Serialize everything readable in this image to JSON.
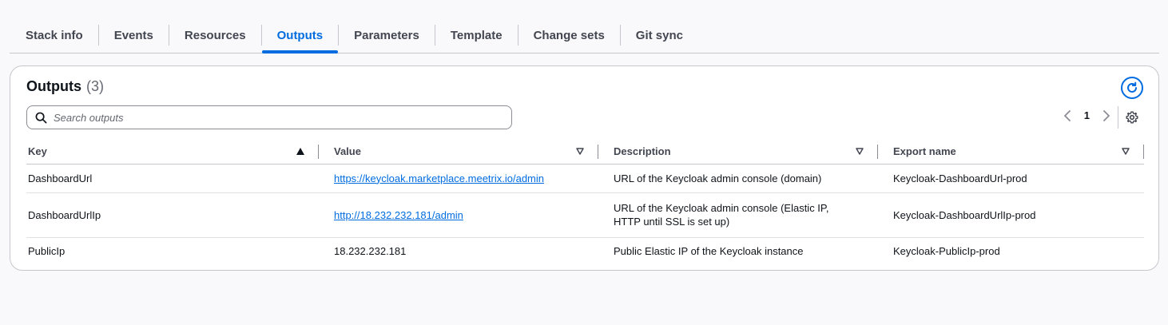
{
  "tabs": [
    {
      "label": "Stack info"
    },
    {
      "label": "Events"
    },
    {
      "label": "Resources"
    },
    {
      "label": "Outputs",
      "active": true
    },
    {
      "label": "Parameters"
    },
    {
      "label": "Template"
    },
    {
      "label": "Change sets"
    },
    {
      "label": "Git sync"
    }
  ],
  "panel": {
    "title": "Outputs",
    "count": "(3)",
    "refresh_icon": "refresh-icon"
  },
  "search": {
    "placeholder": "Search outputs",
    "value": "",
    "icon": "search-icon"
  },
  "pagination": {
    "current_page": "1",
    "prev_icon": "chevron-left-icon",
    "next_icon": "chevron-right-icon",
    "settings_icon": "gear-icon"
  },
  "table": {
    "columns": [
      {
        "label": "Key",
        "sort_icon": "sort-ascending-icon"
      },
      {
        "label": "Value",
        "sort_icon": "sort-icon"
      },
      {
        "label": "Description",
        "sort_icon": "sort-icon"
      },
      {
        "label": "Export name",
        "sort_icon": "sort-icon"
      }
    ],
    "rows": [
      {
        "key": "DashboardUrl",
        "value": "https://keycloak.marketplace.meetrix.io/admin",
        "description": "URL of the Keycloak admin console (domain)",
        "export_name": "Keycloak-DashboardUrl-prod"
      },
      {
        "key": "DashboardUrlIp",
        "value": "http://18.232.232.181/admin",
        "description": "URL of the Keycloak admin console (Elastic IP, HTTP until SSL is set up)",
        "export_name": "Keycloak-DashboardUrlIp-prod"
      },
      {
        "key": "PublicIp",
        "value": "18.232.232.181",
        "description": "Public Elastic IP of the Keycloak instance",
        "export_name": "Keycloak-PublicIp-prod"
      }
    ]
  },
  "colors": {
    "accent": "#006ce0",
    "border": "#c6c6cd",
    "text": "#0f141a",
    "muted": "#656871"
  }
}
